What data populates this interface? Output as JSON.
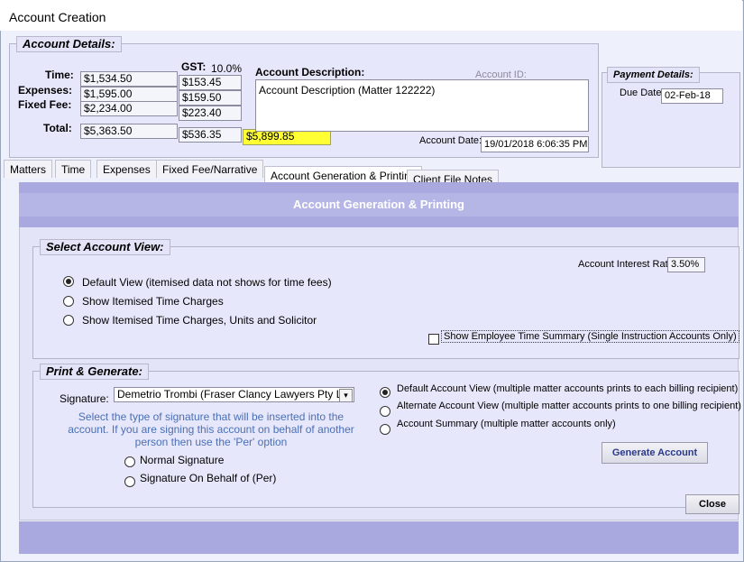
{
  "window": {
    "title": "Account Creation"
  },
  "account_details": {
    "legend": "Account Details:",
    "gst_label": "GST:",
    "gst_rate": "10.0%",
    "rows": [
      {
        "label": "Time:",
        "amount": "$1,534.50",
        "gst": "$153.45"
      },
      {
        "label": "Expenses:",
        "amount": "$1,595.00",
        "gst": "$159.50"
      },
      {
        "label": "Fixed Fee:",
        "amount": "$2,234.00",
        "gst": "$223.40"
      }
    ],
    "total_label": "Total:",
    "total_amount": "$5,363.50",
    "total_gst": "$536.35",
    "grand_total": "$5,899.85",
    "description_label": "Account Description:",
    "description_value": "Account Description (Matter 122222)",
    "account_id_label": "Account ID:",
    "account_date_label": "Account Date:",
    "account_date_value": "19/01/2018 6:06:35 PM"
  },
  "payment_details": {
    "legend": "Payment Details:",
    "due_date_label": "Due Date:",
    "due_date_value": "02-Feb-18"
  },
  "tabs": [
    "Matters",
    "Time",
    "Expenses",
    "Fixed Fee/Narrative",
    "Account Generation & Printing",
    "Client File Notes"
  ],
  "panel": {
    "title": "Account Generation & Printing"
  },
  "select_view": {
    "legend": "Select Account View:",
    "interest_label": "Account Interest Rate:",
    "interest_value": "3.50%",
    "options": [
      "Default View (itemised data not shows for time fees)",
      "Show Itemised Time Charges",
      "Show Itemised Time Charges, Units and Solicitor"
    ],
    "selected": 0,
    "employee_summary_label": "Show Employee Time Summary (Single Instruction Accounts Only)"
  },
  "print_generate": {
    "legend": "Print & Generate:",
    "signature_label": "Signature:",
    "signature_value": "Demetrio Trombi (Fraser Clancy Lawyers Pty Lt",
    "hint": "Select the type of signature that will be inserted into the account. If you are signing this account on behalf of another person then use the 'Per' option",
    "signature_options": [
      "Normal Signature",
      "Signature On Behalf of (Per)"
    ],
    "view_options": [
      "Default Account View (multiple matter accounts prints to each billing recipient)",
      "Alternate Account View (multiple matter accounts prints to one billing recipient)",
      "Account Summary (multiple matter accounts only)"
    ],
    "view_selected": 0,
    "generate_label": "Generate Account"
  },
  "footer": {
    "close_label": "Close"
  },
  "colors": {
    "highlight": "#ffff33",
    "panel_header": "#b6b6e6",
    "fieldset_bg": "#e7e7fb"
  }
}
